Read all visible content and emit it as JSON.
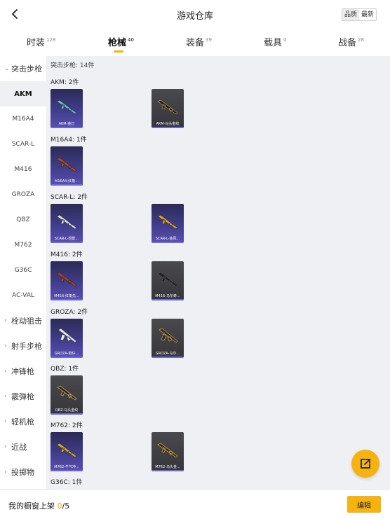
{
  "header": {
    "title": "游戏仓库",
    "sort_options": [
      "品质",
      "最新"
    ],
    "sort_active": "品质"
  },
  "tabs": [
    {
      "label": "时装",
      "count": "128"
    },
    {
      "label": "枪械",
      "count": "40",
      "active": true
    },
    {
      "label": "装备",
      "count": "39"
    },
    {
      "label": "载具",
      "count": "0"
    },
    {
      "label": "战备",
      "count": "28"
    }
  ],
  "sidebar": {
    "groups": [
      {
        "label": "突击步枪",
        "expanded": true,
        "items": [
          "AKM",
          "M16A4",
          "SCAR-L",
          "M416",
          "GROZA",
          "QBZ",
          "M762",
          "G36C",
          "AC-VAL"
        ],
        "active_item": "AKM"
      },
      {
        "label": "栓动狙击"
      },
      {
        "label": "射手步枪"
      },
      {
        "label": "冲锋枪"
      },
      {
        "label": "霰弹枪"
      },
      {
        "label": "轻机枪"
      },
      {
        "label": "近战"
      },
      {
        "label": "投掷物"
      }
    ]
  },
  "content": {
    "summary": "突击步枪: 14件",
    "sections": [
      {
        "title": "AKM: 2件",
        "items": [
          {
            "name": "AKM-金灯",
            "rarity": "purple"
          },
          {
            "name": "AKM-马头金纹",
            "rarity": "gray"
          }
        ]
      },
      {
        "title": "M16A4: 1件",
        "items": [
          {
            "name": "M16A4-红角...",
            "rarity": "purple"
          }
        ]
      },
      {
        "title": "SCAR-L: 2件",
        "items": [
          {
            "name": "SCAR-L-轻影...",
            "rarity": "purple"
          },
          {
            "name": "SCAR-L-金风...",
            "rarity": "purple"
          }
        ]
      },
      {
        "title": "M416: 2件",
        "items": [
          {
            "name": "M416-红角先...",
            "rarity": "purple"
          },
          {
            "name": "M416-马尔奇...",
            "rarity": "gray"
          }
        ]
      },
      {
        "title": "GROZA: 2件",
        "items": [
          {
            "name": "GROZA-狗仔...",
            "rarity": "purple"
          },
          {
            "name": "GROZA-马尔...",
            "rarity": "gray"
          }
        ]
      },
      {
        "title": "QBZ: 1件",
        "items": [
          {
            "name": "QBZ-马头金纹",
            "rarity": "gray"
          }
        ]
      },
      {
        "title": "M762: 2件",
        "items": [
          {
            "name": "M762-牛气冲...",
            "rarity": "purple"
          },
          {
            "name": "M762-马头金...",
            "rarity": "gray"
          }
        ]
      },
      {
        "title": "G36C: 1件",
        "items": []
      }
    ]
  },
  "footer": {
    "label": "我的橱窗上架",
    "current": "0",
    "total": "/5",
    "edit_label": "编辑"
  },
  "colors": {
    "accent": "#f6b20f",
    "content_bg": "#eef0f3",
    "card_purple": "#403d8c",
    "card_gray": "#3d3d42"
  },
  "icons": {
    "back": "chevron-left-icon",
    "fab": "external-link-icon"
  }
}
